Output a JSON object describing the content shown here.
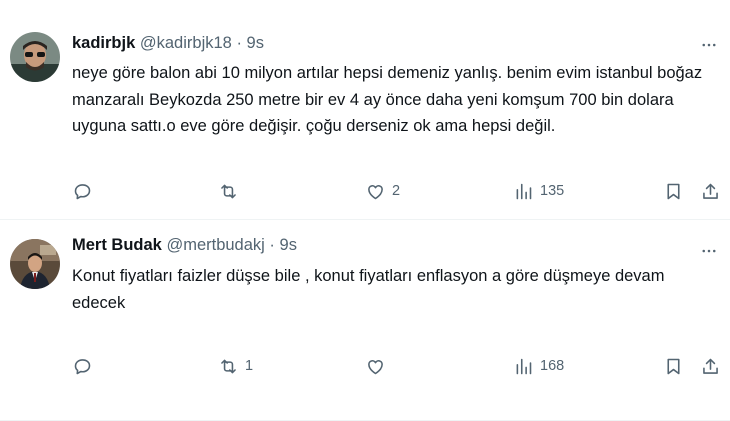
{
  "tweets": [
    {
      "name": "kadirbjk",
      "handle": "@kadirbjk18",
      "separator": "·",
      "time": "9s",
      "text": "neye göre balon abi 10 milyon artılar hepsi demeniz yanlış. benim evim istanbul boğaz manzaralı Beykozda 250 metre bir ev 4 ay önce  daha yeni komşum 700 bin dolara uyguna sattı.o eve göre değişir. çoğu derseniz ok ama hepsi değil.",
      "replies": "",
      "retweets": "",
      "likes": "2",
      "views": "135"
    },
    {
      "name": "Mert Budak",
      "handle": "@mertbudakj",
      "separator": "·",
      "time": "9s",
      "text": "Konut fiyatları faizler düşse bile , konut fiyatları enflasyon a göre düşmeye devam edecek",
      "replies": "",
      "retweets": "1",
      "likes": "",
      "views": "168"
    }
  ],
  "icons": {
    "more": "more-horizontal-icon",
    "reply": "reply-bubble-icon",
    "retweet": "retweet-icon",
    "like": "heart-icon",
    "views": "views-bar-chart-icon",
    "bookmark": "bookmark-icon",
    "share": "share-upload-icon"
  },
  "colors": {
    "text": "#0f1419",
    "secondary": "#536471",
    "divider": "#eff3f4"
  }
}
